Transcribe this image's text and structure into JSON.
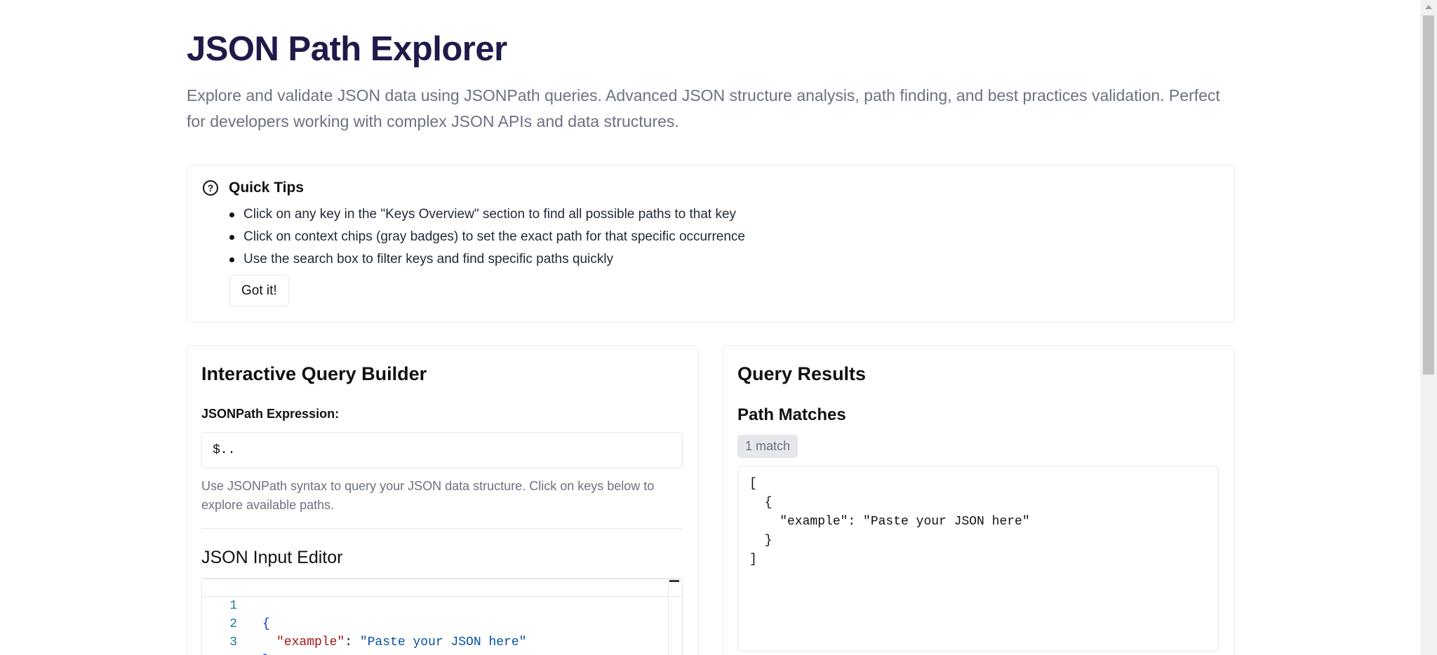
{
  "header": {
    "title": "JSON Path Explorer",
    "subtitle": "Explore and validate JSON data using JSONPath queries. Advanced JSON structure analysis, path finding, and best practices validation. Perfect for developers working with complex JSON APIs and data structures."
  },
  "tips": {
    "icon": "help-circle-icon",
    "title": "Quick Tips",
    "items": [
      "Click on any key in the \"Keys Overview\" section to find all possible paths to that key",
      "Click on context chips (gray badges) to set the exact path for that specific occurrence",
      "Use the search box to filter keys and find specific paths quickly"
    ],
    "button": "Got it!"
  },
  "builder": {
    "title": "Interactive Query Builder",
    "expression_label": "JSONPath Expression:",
    "expression_value": "$..",
    "help": "Use JSONPath syntax to query your JSON data structure. Click on keys below to explore available paths.",
    "editor_title": "JSON Input Editor",
    "editor_lines": [
      {
        "n": "1",
        "brace": "{"
      },
      {
        "n": "2",
        "key": "\"example\"",
        "colon": ": ",
        "value": "\"Paste your JSON here\""
      },
      {
        "n": "3",
        "brace": "}"
      }
    ]
  },
  "results": {
    "title": "Query Results",
    "matches_title": "Path Matches",
    "badge": "1 match",
    "output": "[\n  {\n    \"example\": \"Paste your JSON here\"\n  }\n]"
  },
  "colors": {
    "title": "#1e1b4b",
    "muted": "#6b7280",
    "json_key": "#a31515",
    "json_string": "#0451a5",
    "json_brace": "#0431fa"
  }
}
